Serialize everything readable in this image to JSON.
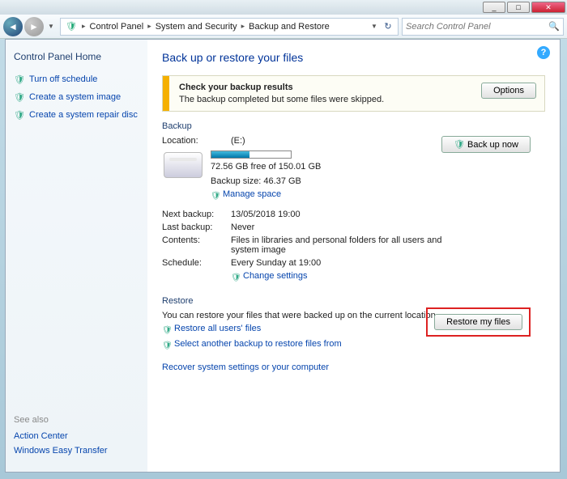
{
  "titlebar": {
    "min": "_",
    "max": "□",
    "close": "✕"
  },
  "toolbar": {
    "back_glyph": "◄",
    "fwd_glyph": "►",
    "drop_glyph": "▼",
    "icon_glyph": "🛡",
    "crumb1": "Control Panel",
    "crumb2": "System and Security",
    "crumb3": "Backup and Restore",
    "sep": "▸",
    "refresh_glyph": "↻",
    "search_placeholder": "Search Control Panel",
    "search_glyph": "🔍"
  },
  "sidebar": {
    "home": "Control Panel Home",
    "links": [
      {
        "icon": "🛡",
        "label": "Turn off schedule"
      },
      {
        "icon": "🛡",
        "label": "Create a system image"
      },
      {
        "icon": "🛡",
        "label": "Create a system repair disc"
      }
    ],
    "seealso_hdr": "See also",
    "seealso": [
      "Action Center",
      "Windows Easy Transfer"
    ]
  },
  "main": {
    "help": "?",
    "title": "Back up or restore your files",
    "notice_title": "Check your backup results",
    "notice_body": "The backup completed but some files were skipped.",
    "options_btn": "Options",
    "backup_hdr": "Backup",
    "location_k": "Location:",
    "location_v": "(E:)",
    "free_text": "72.56 GB free of 150.01 GB",
    "backup_size": "Backup size: 46.37 GB",
    "manage_space": "Manage space",
    "backup_now_btn": "Back up now",
    "progress_pct": 48,
    "next_k": "Next backup:",
    "next_v": "13/05/2018 19:00",
    "last_k": "Last backup:",
    "last_v": "Never",
    "contents_k": "Contents:",
    "contents_v": "Files in libraries and personal folders for all users and system image",
    "schedule_k": "Schedule:",
    "schedule_v": "Every Sunday at 19:00",
    "change_settings": "Change settings",
    "restore_hdr": "Restore",
    "restore_text": "You can restore your files that were backed up on the current location.",
    "restore_all": "Restore all users' files",
    "select_another": "Select another backup to restore files from",
    "recover_sys": "Recover system settings or your computer",
    "restore_btn": "Restore my files"
  }
}
